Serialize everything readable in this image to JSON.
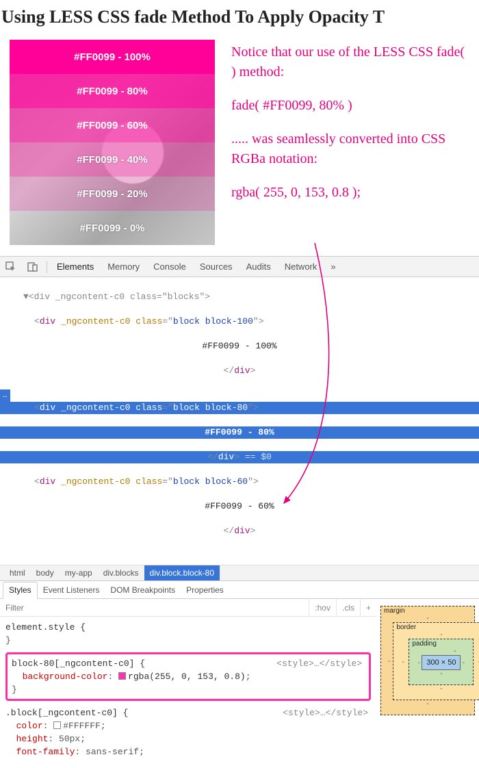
{
  "title": "Using LESS CSS fade Method To Apply Opacity T",
  "demo": {
    "hex": "#FF0099",
    "rows": [
      {
        "pct": "100%",
        "cls": "b100"
      },
      {
        "pct": "80%",
        "cls": "b80"
      },
      {
        "pct": "60%",
        "cls": "b60"
      },
      {
        "pct": "40%",
        "cls": "b40"
      },
      {
        "pct": "20%",
        "cls": "b20"
      },
      {
        "pct": "0%",
        "cls": "b0"
      }
    ]
  },
  "notes": {
    "p1": "Notice that our use of the LESS CSS fade( ) method:",
    "p2": "fade( #FF0099, 80% )",
    "p3": "..... was seamlessly converted into CSS RGBa notation:",
    "p4": "rgba( 255, 0, 153, 0.8 );"
  },
  "devtools": {
    "tabs": [
      "Elements",
      "Memory",
      "Console",
      "Sources",
      "Audits",
      "Network"
    ],
    "more": "»",
    "dom": {
      "topline": "▼<div _ngcontent-c0 class=\"blocks\">",
      "open100_a": "<div _ngcontent-c0 class=\"",
      "open_cls100": "block block-100",
      "open_close": "\">",
      "txt100": "#FF0099 - 100%",
      "close": "</div>",
      "open80_a": "<div _ngcontent-c0 class=\"",
      "open_cls80": "block block-80",
      "txt80": "#FF0099 - 80%",
      "eq0": " == $0",
      "open60_a": "<div _ngcontent-c0 class=\"",
      "open_cls60": "block block-60",
      "txt60": "#FF0099 - 60%",
      "gutter": "…"
    },
    "crumbs": [
      "html",
      "body",
      "my-app",
      "div.blocks",
      "div.block.block-80"
    ],
    "subtabs": [
      "Styles",
      "Event Listeners",
      "DOM Breakpoints",
      "Properties"
    ],
    "filter": {
      "placeholder": "Filter",
      "hov": ":hov",
      "cls": ".cls",
      "plus": "+"
    },
    "rules": {
      "element_style": "element.style {",
      "brace_close": "}",
      "r80_selector": "block-80[_ngcontent-c0] {",
      "r80_prop": "background-color",
      "r80_val": "rgba(255, 0, 153, 0.8)",
      "r80_swatch": "#ff0099cc",
      "style_src": "<style>…</style>",
      "rblock_selector": ".block[_ngcontent-c0] {",
      "rblock_color_prop": "color",
      "rblock_color_val": "#FFFFFF",
      "rblock_height_prop": "height",
      "rblock_height_val": "50px",
      "rblock_ff_prop": "font-family",
      "rblock_ff_val": "sans-serif"
    },
    "boxmodel": {
      "margin": "margin",
      "border": "border",
      "padding": "padding",
      "content": "300 × 50",
      "dash": "-"
    }
  }
}
